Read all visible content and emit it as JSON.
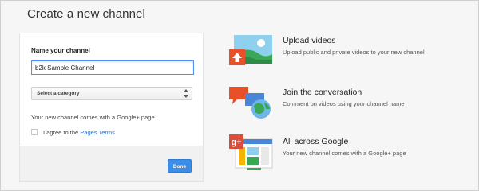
{
  "dialog": {
    "title": "Create a new channel"
  },
  "form": {
    "name_label": "Name your channel",
    "name_value": "b2k Sample Channel",
    "category_selected": "Select a category",
    "gplus_note": "Your new channel comes with a Google+ page",
    "agree_prefix": "I agree to the ",
    "agree_link": "Pages Terms",
    "agree_checked": false,
    "done_label": "Done"
  },
  "features": [
    {
      "icon": "upload-videos-icon",
      "title": "Upload videos",
      "desc": "Upload public and private videos to your new channel"
    },
    {
      "icon": "conversation-icon",
      "title": "Join the conversation",
      "desc": "Comment on videos using your channel name"
    },
    {
      "icon": "google-plus-page-icon",
      "title": "All across Google",
      "desc": "Your new channel comes with a Google+ page"
    }
  ],
  "colors": {
    "accent_blue": "#3b8ee8",
    "link_blue": "#2a6bcc",
    "focus_border": "#4d90fe",
    "upload_red": "#e8502a",
    "gplus_red": "#dd4b39",
    "google_green": "#3aa757",
    "google_yellow": "#f4b400"
  }
}
